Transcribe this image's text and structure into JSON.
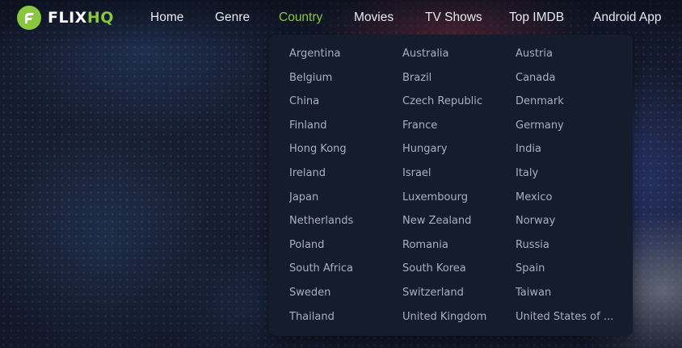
{
  "brand": {
    "name_prefix": "FLIX",
    "name_suffix": "HQ",
    "accent_color": "#8bc63f"
  },
  "nav": {
    "items": [
      {
        "label": "Home"
      },
      {
        "label": "Genre"
      },
      {
        "label": "Country",
        "active": true
      },
      {
        "label": "Movies"
      },
      {
        "label": "TV Shows"
      },
      {
        "label": "Top IMDB"
      },
      {
        "label": "Android App"
      }
    ]
  },
  "country_menu": {
    "items": [
      "Argentina",
      "Australia",
      "Austria",
      "Belgium",
      "Brazil",
      "Canada",
      "China",
      "Czech Republic",
      "Denmark",
      "Finland",
      "France",
      "Germany",
      "Hong Kong",
      "Hungary",
      "India",
      "Ireland",
      "Israel",
      "Italy",
      "Japan",
      "Luxembourg",
      "Mexico",
      "Netherlands",
      "New Zealand",
      "Norway",
      "Poland",
      "Romania",
      "Russia",
      "South Africa",
      "South Korea",
      "Spain",
      "Sweden",
      "Switzerland",
      "Taiwan",
      "Thailand",
      "United Kingdom",
      "United States of ..."
    ]
  },
  "colors": {
    "header_text": "#e6e9ef",
    "active_nav": "#8bc63f",
    "menu_bg": "#151c2b",
    "menu_text": "#a9b0bd"
  }
}
